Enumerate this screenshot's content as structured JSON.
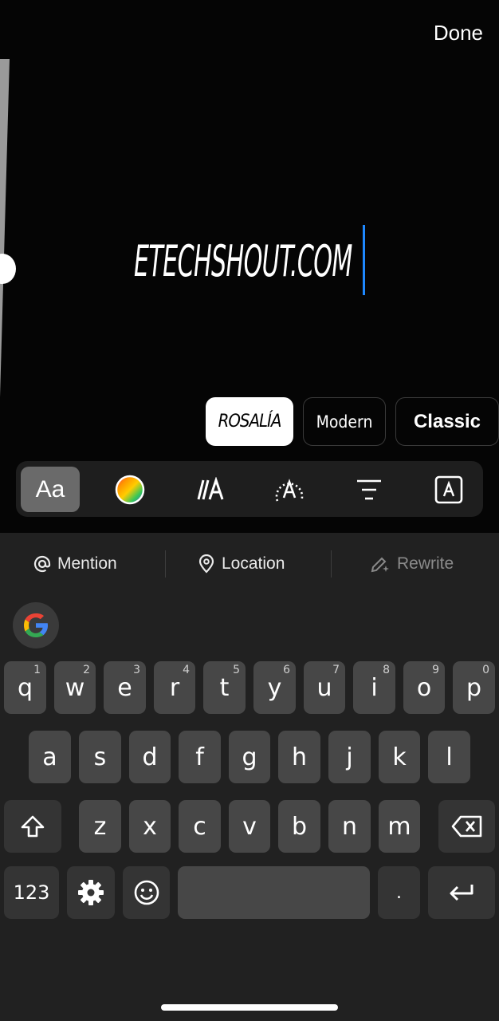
{
  "editor": {
    "done_label": "Done",
    "story_text": "ETECHSHOUT.COM",
    "fonts": [
      {
        "label": "ROSALÍA",
        "selected": true
      },
      {
        "label": "Modern",
        "selected": false
      },
      {
        "label": "Classic",
        "selected": false
      }
    ],
    "toolbar": {
      "font_label": "Aa",
      "icons": [
        "font-style-icon",
        "color-wheel-icon",
        "text-effect-icon",
        "animate-text-icon",
        "align-center-icon",
        "text-background-icon"
      ],
      "background_letter": "A"
    },
    "accent_caret": "#1e88ff"
  },
  "keyboard": {
    "suggestions": [
      {
        "label": "Mention",
        "icon": "at-icon"
      },
      {
        "label": "Location",
        "icon": "location-pin-icon"
      },
      {
        "label": "Rewrite",
        "icon": "pencil-sparkle-icon",
        "dim": true
      }
    ],
    "row1": [
      {
        "k": "q",
        "n": "1"
      },
      {
        "k": "w",
        "n": "2"
      },
      {
        "k": "e",
        "n": "3"
      },
      {
        "k": "r",
        "n": "4"
      },
      {
        "k": "t",
        "n": "5"
      },
      {
        "k": "y",
        "n": "6"
      },
      {
        "k": "u",
        "n": "7"
      },
      {
        "k": "i",
        "n": "8"
      },
      {
        "k": "o",
        "n": "9"
      },
      {
        "k": "p",
        "n": "0"
      }
    ],
    "row2": [
      "a",
      "s",
      "d",
      "f",
      "g",
      "h",
      "j",
      "k",
      "l"
    ],
    "row3": [
      "z",
      "x",
      "c",
      "v",
      "b",
      "n",
      "m"
    ],
    "numbers_label": "123",
    "period_label": "."
  }
}
